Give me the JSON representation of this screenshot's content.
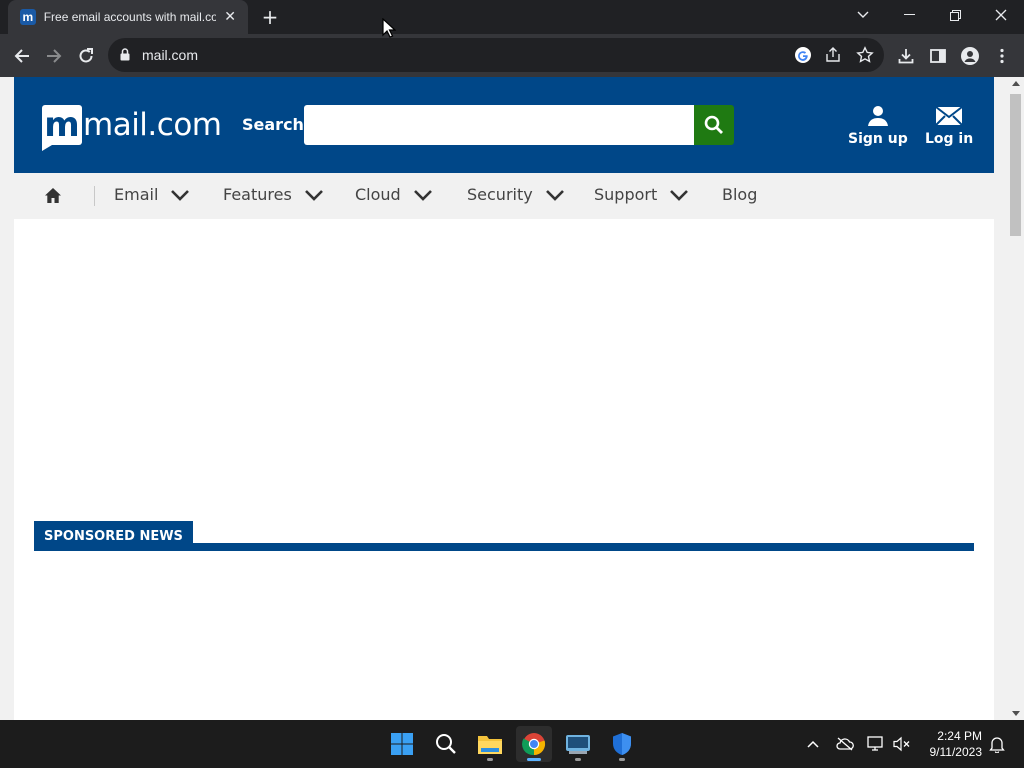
{
  "browser": {
    "tab_title": "Free email accounts with mail.com",
    "favicon_letter": "m",
    "url": "mail.com"
  },
  "header": {
    "logo_text": "mail.com",
    "logo_letter": "m",
    "search_label": "Search",
    "search_placeholder": "",
    "signup_label": "Sign up",
    "login_label": "Log in"
  },
  "nav": {
    "items": [
      {
        "label": "Email"
      },
      {
        "label": "Features"
      },
      {
        "label": "Cloud"
      },
      {
        "label": "Security"
      },
      {
        "label": "Support"
      },
      {
        "label": "Blog"
      }
    ]
  },
  "content": {
    "sponsored_label": "SPONSORED NEWS"
  },
  "taskbar": {
    "time": "2:24 PM",
    "date": "9/11/2023"
  },
  "colors": {
    "brand_blue": "#004788",
    "search_green": "#1f7a12"
  }
}
